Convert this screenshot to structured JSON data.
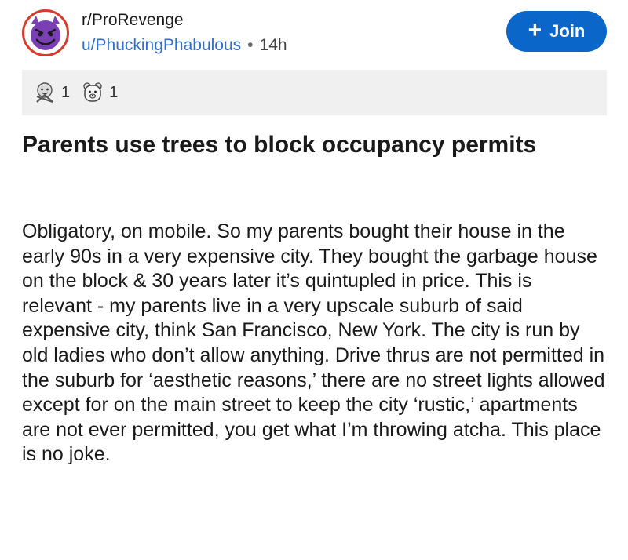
{
  "post": {
    "subreddit": "r/ProRevenge",
    "author": "u/PhuckingPhabulous",
    "separator": "•",
    "age": "14h",
    "join_label": "Join",
    "awards": [
      {
        "icon": "wholesome-award-icon",
        "count": "1"
      },
      {
        "icon": "bear-award-icon",
        "count": "1"
      }
    ],
    "title": "Parents use trees to block occupancy permits",
    "body": "Obligatory, on mobile. So my parents bought their house in the early 90s in a very expensive city. They bought the garbage house on the block &  30 years later it’s quintupled in price. This is relevant - my parents live in a very upscale suburb of said expensive city, think San Francisco, New York. The city is run by old ladies who don’t allow anything. Drive thrus are not permitted in the suburb for ‘aesthetic reasons,’ there are no street lights allowed except for on the main street to keep the city ‘rustic,’ apartments are not ever permitted, you get what I’m throwing atcha.  This place is no joke."
  },
  "colors": {
    "join_button": "#0a66c8",
    "user_link": "#2f6fd0",
    "avatar_face": "#7b3fb5",
    "avatar_ring": "#d93a2b",
    "award_bar": "#f0f0f0"
  }
}
